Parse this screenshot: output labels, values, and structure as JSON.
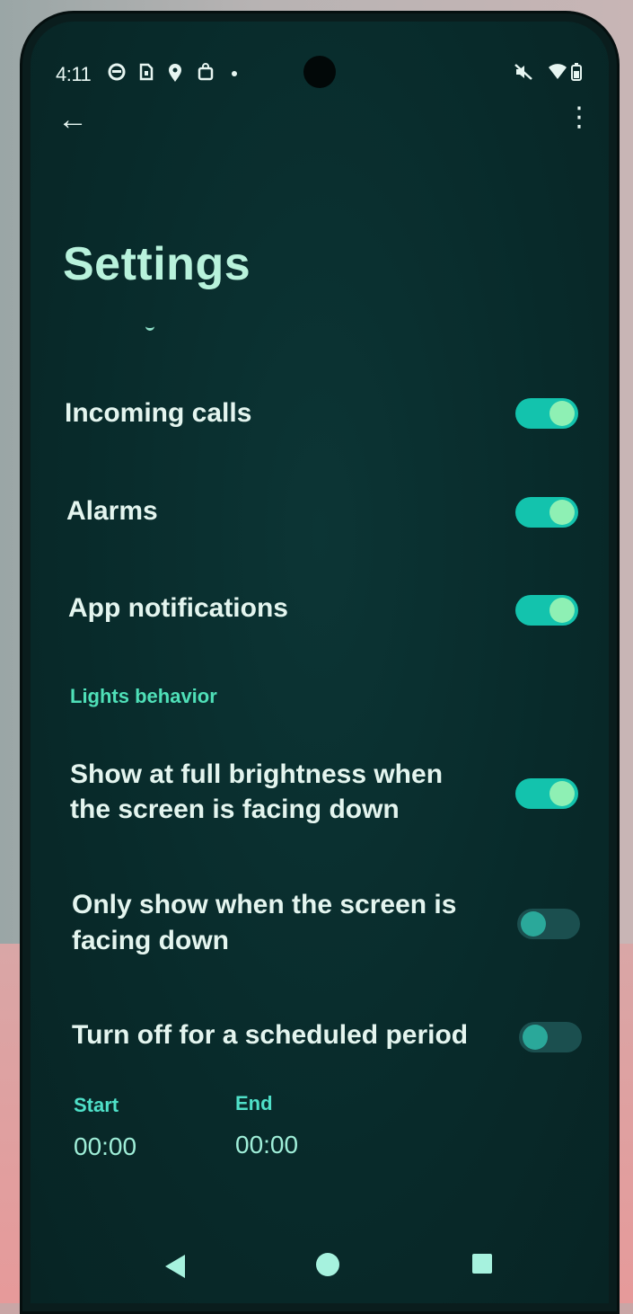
{
  "status_bar": {
    "time": "4:11",
    "icons": [
      "privacy-dot-icon",
      "sim-icon",
      "location-icon",
      "bag-icon",
      "dot-icon",
      "mute-icon",
      "wifi-icon",
      "battery-icon"
    ]
  },
  "header": {
    "back_icon": "←",
    "more_icon": "⋮",
    "title": "Settings"
  },
  "settings": {
    "incoming_calls": {
      "label": "Incoming calls",
      "enabled": true
    },
    "alarms": {
      "label": "Alarms",
      "enabled": true
    },
    "app_notifications": {
      "label": "App notifications",
      "enabled": true
    },
    "lights_section": "Lights behavior",
    "full_brightness": {
      "label_line1": "Show at full brightness when",
      "label_line2": "the screen is facing down",
      "enabled": true
    },
    "only_facing_down": {
      "label_line1": "Only show when the screen is",
      "label_line2": "facing down",
      "enabled": false
    },
    "scheduled_off": {
      "label": "Turn off for a scheduled period",
      "enabled": false
    },
    "schedule": {
      "start_label": "Start",
      "start_value": "00:00",
      "end_label": "End",
      "end_value": "00:00"
    }
  },
  "colors": {
    "accent": "#13c3ad",
    "title": "#b8f2dc",
    "section": "#4fe0b8",
    "background": "#082a2a"
  }
}
